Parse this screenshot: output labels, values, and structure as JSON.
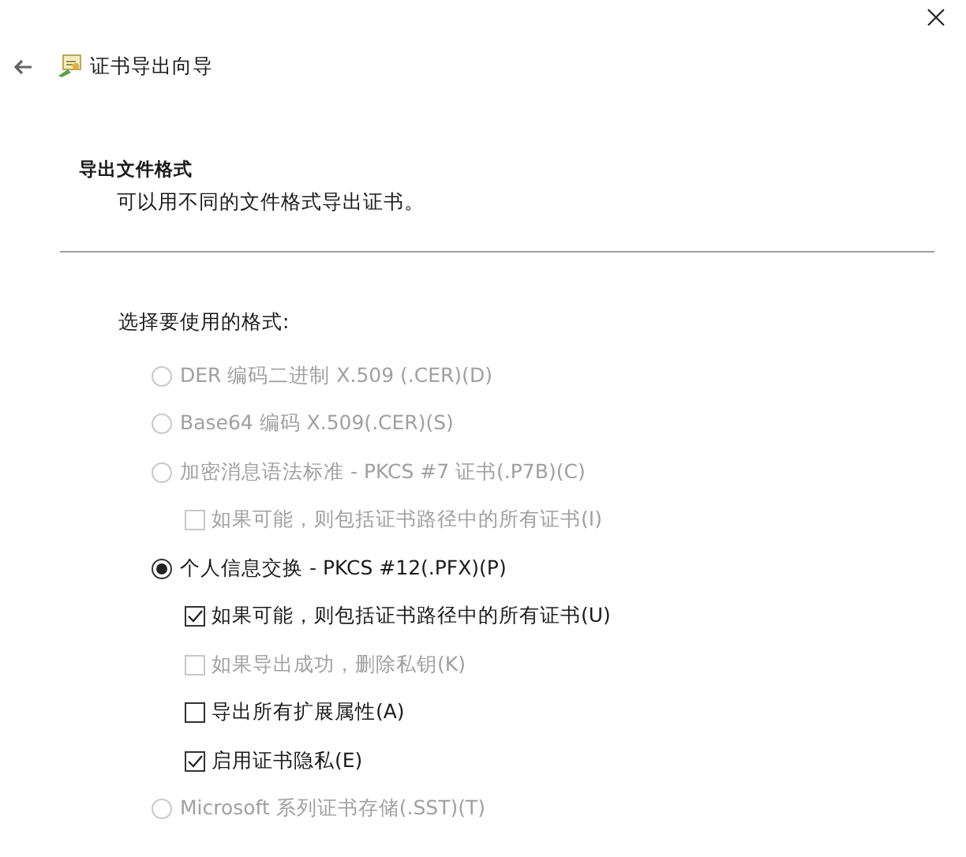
{
  "wizard": {
    "title": "证书导出向导"
  },
  "section": {
    "heading": "导出文件格式",
    "description": "可以用不同的文件格式导出证书。"
  },
  "prompt": "选择要使用的格式:",
  "options": [
    {
      "kind": "radio",
      "label": "DER 编码二进制 X.509 (.CER)(D)",
      "selected": false,
      "disabled": true
    },
    {
      "kind": "radio",
      "label": "Base64 编码 X.509(.CER)(S)",
      "selected": false,
      "disabled": true
    },
    {
      "kind": "radio",
      "label": "加密消息语法标准 - PKCS #7 证书(.P7B)(C)",
      "selected": false,
      "disabled": true
    },
    {
      "kind": "checkbox",
      "label": "如果可能，则包括证书路径中的所有证书(I)",
      "checked": false,
      "disabled": true
    },
    {
      "kind": "radio",
      "label": "个人信息交换 - PKCS #12(.PFX)(P)",
      "selected": true,
      "disabled": false
    },
    {
      "kind": "checkbox",
      "label": "如果可能，则包括证书路径中的所有证书(U)",
      "checked": true,
      "disabled": false
    },
    {
      "kind": "checkbox",
      "label": "如果导出成功，删除私钥(K)",
      "checked": false,
      "disabled": true
    },
    {
      "kind": "checkbox",
      "label": "导出所有扩展属性(A)",
      "checked": false,
      "disabled": false
    },
    {
      "kind": "checkbox",
      "label": "启用证书隐私(E)",
      "checked": true,
      "disabled": false
    },
    {
      "kind": "radio",
      "label": "Microsoft 系列证书存储(.SST)(T)",
      "selected": false,
      "disabled": true
    }
  ]
}
